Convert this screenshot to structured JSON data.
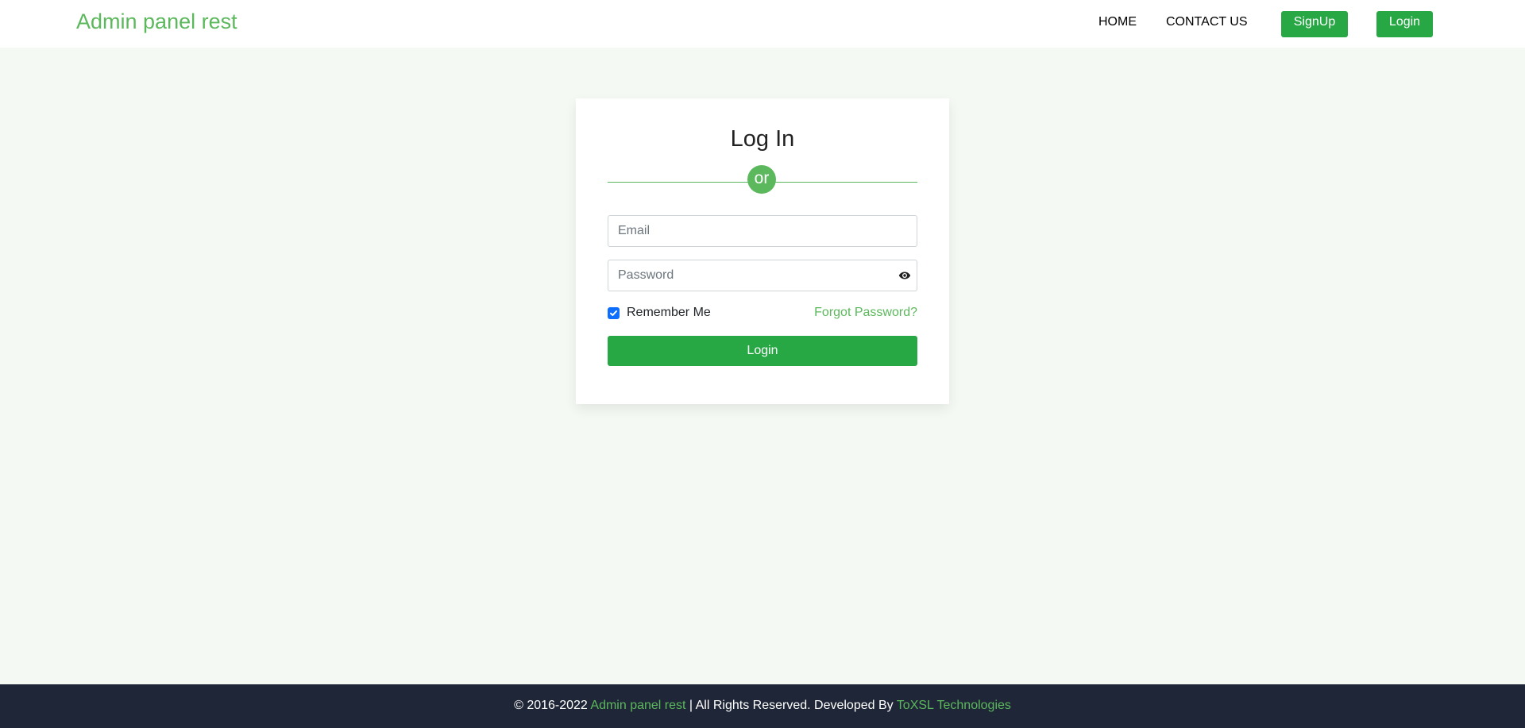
{
  "header": {
    "brand": "Admin panel rest",
    "nav": {
      "home": "HOME",
      "contact": "CONTACT US",
      "signup": "SignUp",
      "login": "Login"
    }
  },
  "login_card": {
    "title": "Log In",
    "divider_text": "or",
    "email": {
      "placeholder": "Email",
      "value": ""
    },
    "password": {
      "placeholder": "Password",
      "value": ""
    },
    "show_password_icon": "eye-icon",
    "remember_me": {
      "label": "Remember Me",
      "checked": true
    },
    "forgot_password": "Forgot Password?",
    "submit_label": "Login"
  },
  "footer": {
    "copyright": "© 2016-2022",
    "brand_link": "Admin panel rest",
    "rights_text": "| All Rights Reserved. Developed By",
    "developer_link": "ToXSL Technologies"
  },
  "colors": {
    "brand": "#5cb85c",
    "primary_button": "#28a745",
    "page_background": "#f5f9f3",
    "footer_background": "#1f2637",
    "checkbox": "#0d6efd"
  }
}
